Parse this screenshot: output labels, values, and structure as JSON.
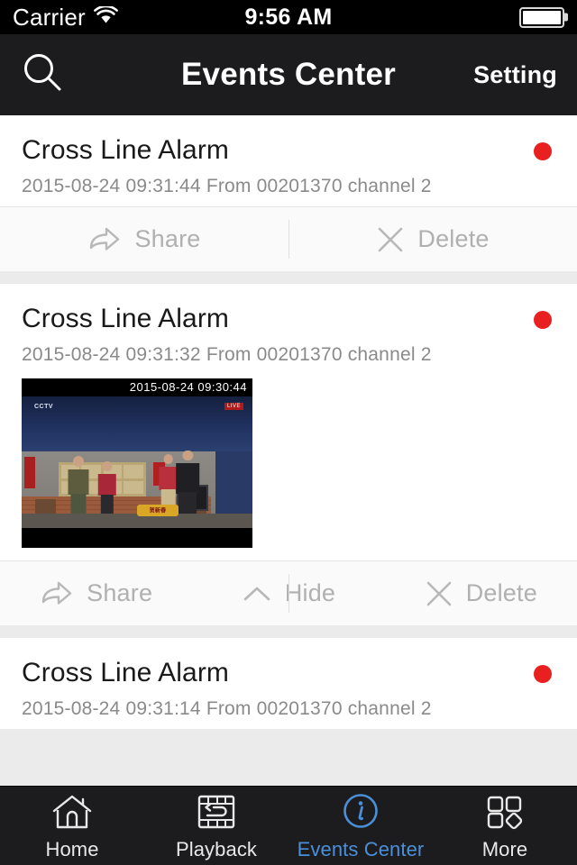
{
  "status_bar": {
    "carrier": "Carrier",
    "wifi_icon": "wifi-icon",
    "time": "9:56 AM",
    "battery_icon": "battery-full-icon"
  },
  "nav_bar": {
    "search_icon": "search-icon",
    "title": "Events Center",
    "setting_label": "Setting"
  },
  "colors": {
    "status_bar_bg": "#000000",
    "nav_bar_bg": "#1c1c1e",
    "list_bg": "#ebebeb",
    "card_bg": "#ffffff",
    "unread_dot": "#e8201f",
    "action_text": "#b0b0b0",
    "active_tab": "#4a90d9",
    "tab_text": "#e8e8e8"
  },
  "events": [
    {
      "title": "Cross Line Alarm",
      "meta": "2015-08-24 09:31:44  From 00201370 channel 2",
      "unread": true,
      "has_thumbnail": false,
      "actions": [
        {
          "label": "Share",
          "icon": "share-arrow-icon"
        },
        {
          "label": "Delete",
          "icon": "close-x-icon"
        }
      ]
    },
    {
      "title": "Cross Line Alarm",
      "meta": "2015-08-24 09:31:32  From 00201370 channel 2",
      "unread": true,
      "has_thumbnail": true,
      "thumbnail_timestamp": "2015-08-24 09:30:44",
      "thumbnail_caption": "CCTV",
      "thumbnail_badge": "LIVE",
      "thumbnail_prop_text": "贺新春",
      "actions": [
        {
          "label": "Share",
          "icon": "share-arrow-icon"
        },
        {
          "label": "Hide",
          "icon": "chevron-up-icon"
        },
        {
          "label": "Delete",
          "icon": "close-x-icon"
        }
      ]
    },
    {
      "title": "Cross Line Alarm",
      "meta": "2015-08-24 09:31:14  From 00201370 channel 2",
      "unread": true,
      "has_thumbnail": false,
      "actions": []
    }
  ],
  "tab_bar": {
    "tabs": [
      {
        "label": "Home",
        "icon": "home-icon",
        "active": false
      },
      {
        "label": "Playback",
        "icon": "playback-film-icon",
        "active": false
      },
      {
        "label": "Events Center",
        "icon": "info-circle-icon",
        "active": true
      },
      {
        "label": "More",
        "icon": "grid-more-icon",
        "active": false
      }
    ]
  }
}
